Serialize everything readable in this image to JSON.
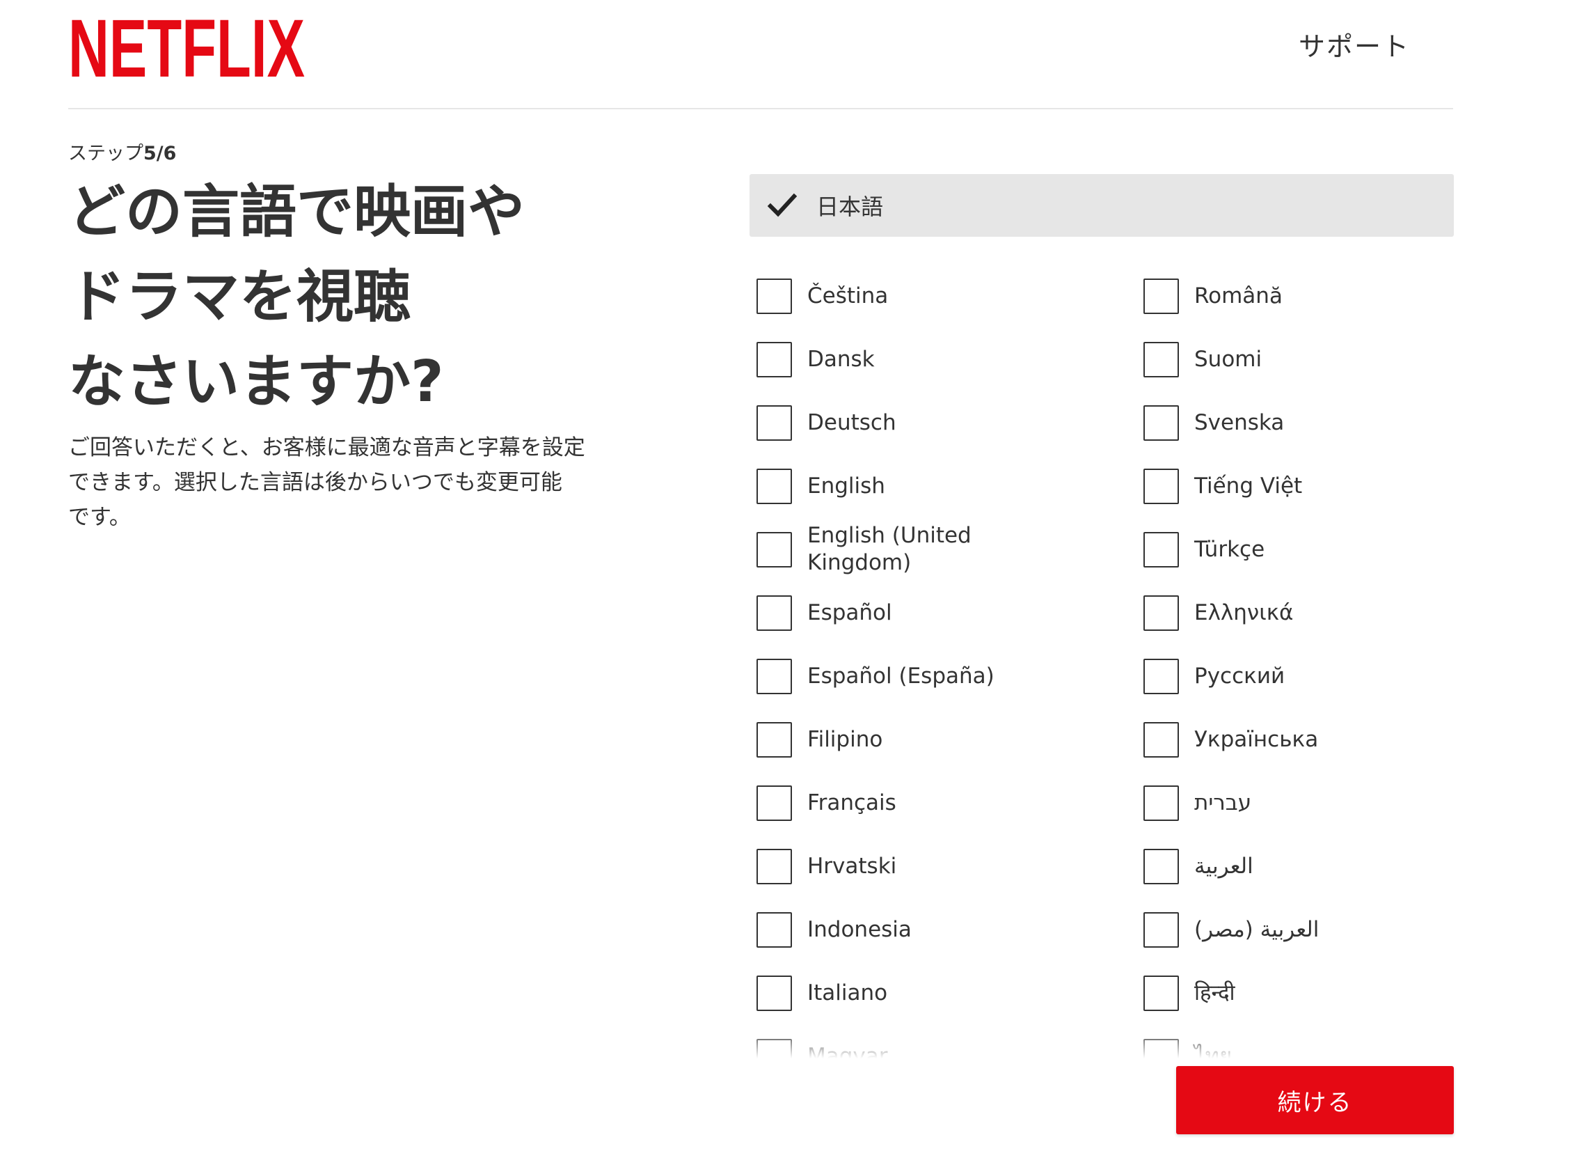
{
  "header": {
    "logo_text": "NETFLIX",
    "support_label": "サポート"
  },
  "step": {
    "prefix": "ステップ",
    "count": "5/6"
  },
  "main": {
    "title_lines": [
      "どの言語で映画や",
      "ドラマを視聴",
      "なさいますか?"
    ],
    "description_lines": [
      "ご回答いただくと、お客様に最適な音声と字幕を設定",
      "できます。選択した言語は後からいつでも変更可能",
      "です。"
    ]
  },
  "primary_language": {
    "label": "日本語",
    "checked": true
  },
  "languages": {
    "left": [
      "Čeština",
      "Dansk",
      "Deutsch",
      "English",
      "English (United Kingdom)",
      "Español",
      "Español (España)",
      "Filipino",
      "Français",
      "Hrvatski",
      "Indonesia",
      "Italiano",
      "Magyar"
    ],
    "right": [
      "Română",
      "Suomi",
      "Svenska",
      "Tiếng Việt",
      "Türkçe",
      "Ελληνικά",
      "Русский",
      "Українська",
      "עברית",
      "العربية",
      "العربية (مصر)",
      "हिन्दी",
      "ไทย"
    ]
  },
  "continue_label": "続ける",
  "colors": {
    "brand_red": "#e50914",
    "text": "#333333",
    "panel_gray": "#e6e6e6"
  }
}
